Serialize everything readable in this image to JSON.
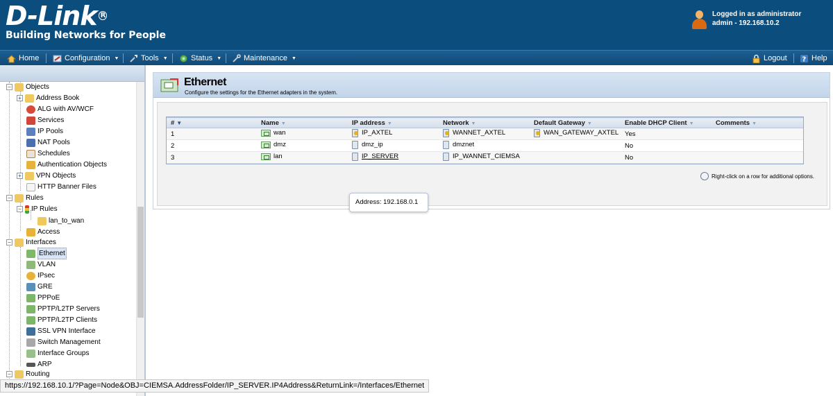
{
  "brand": {
    "name": "D-Link",
    "tagline": "Building Networks for People",
    "color": "#0b4d7d"
  },
  "user": {
    "line1": "Logged in as administrator",
    "line2": "admin - 192.168.10.2"
  },
  "menu": {
    "home": "Home",
    "configuration": "Configuration",
    "tools": "Tools",
    "status": "Status",
    "maintenance": "Maintenance",
    "logout": "Logout",
    "help": "Help"
  },
  "tree": {
    "objects": "Objects",
    "address_book": "Address Book",
    "alg": "ALG with AV/WCF",
    "services": "Services",
    "ip_pools": "IP Pools",
    "nat_pools": "NAT Pools",
    "schedules": "Schedules",
    "auth_objects": "Authentication Objects",
    "vpn_objects": "VPN Objects",
    "http_banner": "HTTP Banner Files",
    "rules": "Rules",
    "ip_rules": "IP Rules",
    "lan_to_wan": "lan_to_wan",
    "access": "Access",
    "interfaces": "Interfaces",
    "ethernet": "Ethernet",
    "vlan": "VLAN",
    "ipsec": "IPsec",
    "gre": "GRE",
    "pppoe": "PPPoE",
    "pptp_servers": "PPTP/L2TP Servers",
    "pptp_clients": "PPTP/L2TP Clients",
    "ssl_vpn": "SSL VPN Interface",
    "switch_mgmt": "Switch Management",
    "iface_groups": "Interface Groups",
    "arp": "ARP",
    "routing": "Routing"
  },
  "page": {
    "title": "Ethernet",
    "subtitle": "Configure the settings for the Ethernet adapters in the system."
  },
  "table": {
    "headers": [
      "#",
      "Name",
      "IP address",
      "Network",
      "Default Gateway",
      "Enable DHCP Client",
      "Comments"
    ],
    "rows": [
      {
        "num": "1",
        "name": "wan",
        "ip": "IP_AXTEL",
        "network": "WANNET_AXTEL",
        "gateway": "WAN_GATEWAY_AXTEL",
        "dhcp": "Yes",
        "comments": ""
      },
      {
        "num": "2",
        "name": "dmz",
        "ip": "dmz_ip",
        "network": "dmznet",
        "gateway": "",
        "dhcp": "No",
        "comments": ""
      },
      {
        "num": "3",
        "name": "lan",
        "ip": "IP_SERVER",
        "network": "IP_WANNET_CIEMSA",
        "gateway": "",
        "dhcp": "No",
        "comments": ""
      }
    ]
  },
  "tooltip": "Address: 192.168.0.1",
  "hint": "Right-click on a row for additional options.",
  "status_url": "https://192.168.10.1/?Page=Node&OBJ=CIEMSA.AddressFolder/IP_SERVER.IP4Address&ReturnLink=/Interfaces/Ethernet"
}
